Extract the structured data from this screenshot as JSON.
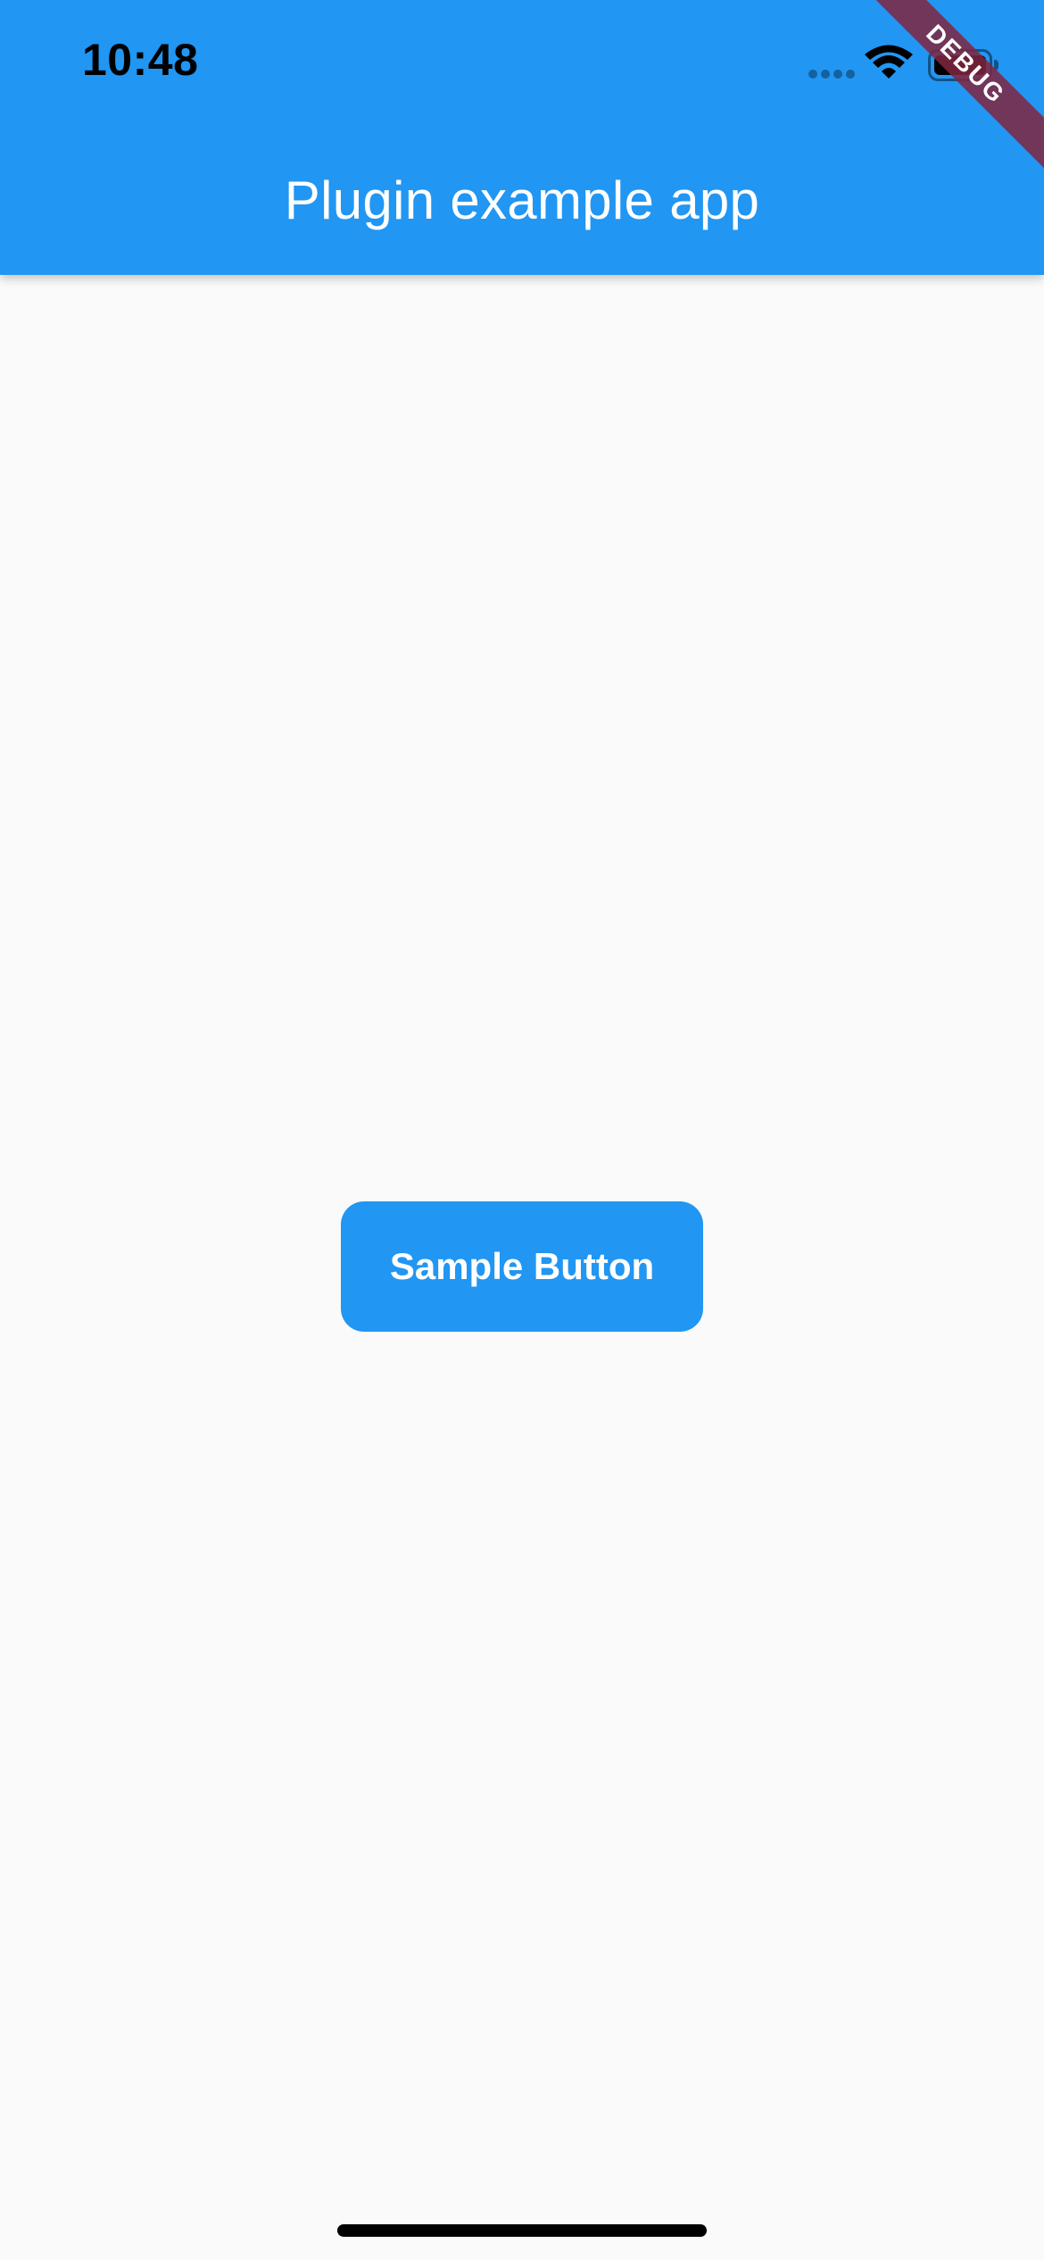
{
  "status_bar": {
    "time": "10:48",
    "icons": [
      "signal-icon",
      "wifi-icon",
      "battery-icon"
    ]
  },
  "app_bar": {
    "title": "Plugin example app",
    "color": "#2196f3"
  },
  "debug_banner": {
    "label": "DEBUG",
    "color": "#802640"
  },
  "main": {
    "sample_button_label": "Sample Button",
    "button_color": "#2196f3"
  }
}
